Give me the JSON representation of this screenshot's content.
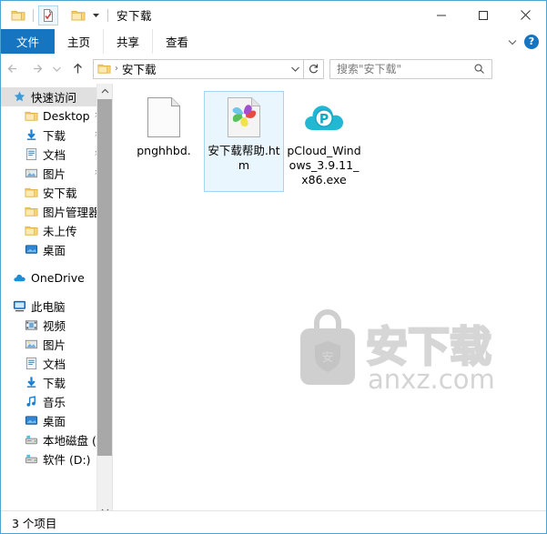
{
  "window": {
    "title": "安下载",
    "accent_blue": "#1675c0",
    "border_color": "#4fa3d1",
    "controls": {
      "minimize": "minimize-button",
      "maximize": "maximize-button",
      "close": "close-button"
    }
  },
  "quick_access_toolbar": {
    "items": [
      {
        "name": "folder-icon",
        "label": ""
      },
      {
        "name": "properties-icon",
        "label": "",
        "active": true
      },
      {
        "name": "new-folder-icon",
        "label": ""
      },
      {
        "name": "customize-dropdown",
        "label": ""
      }
    ]
  },
  "ribbon": {
    "tabs": [
      {
        "label": "文件",
        "selected": true
      },
      {
        "label": "主页",
        "selected": false
      },
      {
        "label": "共享",
        "selected": false
      },
      {
        "label": "查看",
        "selected": false
      }
    ],
    "expand_label": "",
    "help_label": "?"
  },
  "address_bar": {
    "back": "",
    "forward": "",
    "recent": "",
    "up": "",
    "breadcrumb": "安下载",
    "breadcrumb_separator": "›",
    "dropdown": "",
    "refresh": ""
  },
  "search": {
    "placeholder": "搜索\"安下载\"",
    "value": ""
  },
  "sidebar": {
    "items": [
      {
        "label": "快速访问",
        "icon": "pin-star-icon",
        "level": 0,
        "selected": true,
        "pinned": false
      },
      {
        "label": "Desktop",
        "icon": "folder-icon",
        "level": 1,
        "selected": false,
        "pinned": true
      },
      {
        "label": "下载",
        "icon": "downloads-icon",
        "level": 1,
        "selected": false,
        "pinned": true
      },
      {
        "label": "文档",
        "icon": "documents-icon",
        "level": 1,
        "selected": false,
        "pinned": true
      },
      {
        "label": "图片",
        "icon": "pictures-icon",
        "level": 1,
        "selected": false,
        "pinned": true
      },
      {
        "label": "安下载",
        "icon": "folder-icon",
        "level": 1,
        "selected": false,
        "pinned": false
      },
      {
        "label": "图片管理器",
        "icon": "folder-icon",
        "level": 1,
        "selected": false,
        "pinned": false
      },
      {
        "label": "未上传",
        "icon": "folder-icon",
        "level": 1,
        "selected": false,
        "pinned": false
      },
      {
        "label": "桌面",
        "icon": "desktop-icon",
        "level": 1,
        "selected": false,
        "pinned": false
      },
      {
        "label": "OneDrive",
        "icon": "onedrive-cloud-icon",
        "level": 0,
        "selected": false,
        "pinned": false
      },
      {
        "label": "此电脑",
        "icon": "this-pc-icon",
        "level": 0,
        "selected": false,
        "pinned": false
      },
      {
        "label": "视频",
        "icon": "videos-icon",
        "level": 1,
        "selected": false,
        "pinned": false
      },
      {
        "label": "图片",
        "icon": "pictures-icon",
        "level": 1,
        "selected": false,
        "pinned": false
      },
      {
        "label": "文档",
        "icon": "documents-icon",
        "level": 1,
        "selected": false,
        "pinned": false
      },
      {
        "label": "下载",
        "icon": "downloads-icon",
        "level": 1,
        "selected": false,
        "pinned": false
      },
      {
        "label": "音乐",
        "icon": "music-icon",
        "level": 1,
        "selected": false,
        "pinned": false
      },
      {
        "label": "桌面",
        "icon": "desktop-icon",
        "level": 1,
        "selected": false,
        "pinned": false
      },
      {
        "label": "本地磁盘 (C",
        "icon": "drive-icon",
        "level": 1,
        "selected": false,
        "pinned": false
      },
      {
        "label": "软件 (D:)",
        "icon": "drive-icon",
        "level": 1,
        "selected": false,
        "pinned": false
      }
    ],
    "scroll": {
      "up_arrow": "▲",
      "down_arrow": "▼"
    }
  },
  "files": [
    {
      "name": "pnghhbd.",
      "icon": "blank-document-icon",
      "selected": false
    },
    {
      "name": "安下载帮助.htm",
      "icon": "html-pinwheel-icon",
      "selected": true
    },
    {
      "name": "pCloud_Windows_3.9.11_x86.exe",
      "icon": "pcloud-icon",
      "selected": false
    }
  ],
  "watermark": {
    "text_cn": "安下载",
    "text_en": "anxz.com",
    "badge_char": "安",
    "color": "#d4d4d4"
  },
  "status_bar": {
    "item_count": "3 个项目"
  }
}
